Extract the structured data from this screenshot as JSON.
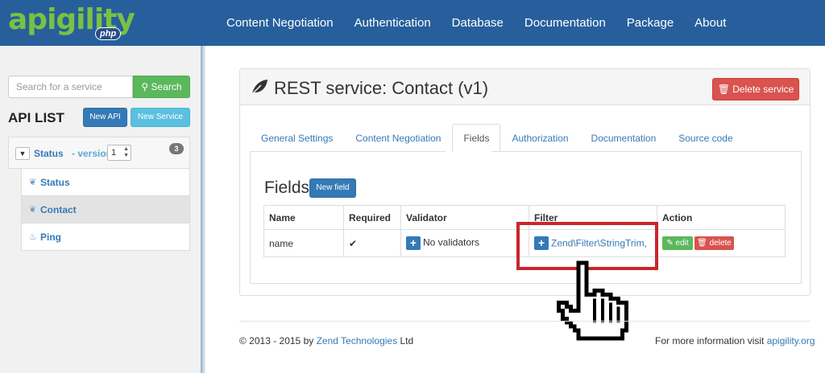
{
  "brand": {
    "logo_text": "apigility",
    "logo_badge": "php"
  },
  "nav": {
    "items": [
      "Content Negotiation",
      "Authentication",
      "Database",
      "Documentation",
      "Package",
      "About"
    ]
  },
  "sidebar": {
    "search_placeholder": "Search for a service",
    "search_button": "Search",
    "api_list_title": "API LIST",
    "new_api_button": "New API",
    "new_service_button": "New Service",
    "api": {
      "name": "Status",
      "version_label": "- version",
      "version_value": "1",
      "service_count": "3"
    },
    "services": [
      {
        "label": "Status",
        "icon": "leaf-icon",
        "active": false
      },
      {
        "label": "Contact",
        "icon": "leaf-icon",
        "active": true
      },
      {
        "label": "Ping",
        "icon": "fire-icon",
        "active": false
      }
    ]
  },
  "main": {
    "title": "REST service: Contact (v1)",
    "delete_service_button": "Delete service",
    "tabs": [
      "General Settings",
      "Content Negotiation",
      "Fields",
      "Authorization",
      "Documentation",
      "Source code"
    ],
    "active_tab": "Fields",
    "fields_title": "Fields",
    "new_field_button": "New field",
    "table": {
      "headers": [
        "Name",
        "Required",
        "Validator",
        "Filter",
        "Action"
      ],
      "rows": [
        {
          "name": "name",
          "required": "✔",
          "validator": "No validators",
          "filter": "Zend\\Filter\\StringTrim,",
          "edit": "edit",
          "delete": "delete"
        }
      ]
    }
  },
  "footer": {
    "copyright_prefix": "© 2013 - 2015 by ",
    "company_link": "Zend Technologies",
    "copyright_suffix": " Ltd",
    "info_prefix": "For more information visit ",
    "info_link": "apigility.org"
  },
  "colors": {
    "navbar": "#275f9c",
    "accent": "#7ac143",
    "highlight": "#c8262d"
  }
}
